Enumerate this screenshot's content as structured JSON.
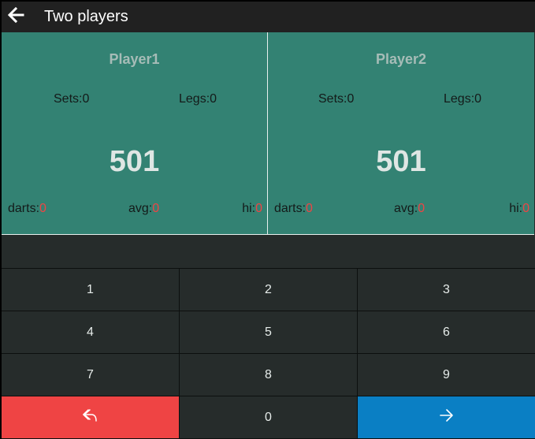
{
  "appbar": {
    "title": "Two players",
    "back_icon": "arrow-left-icon"
  },
  "players": [
    {
      "name": "Player1",
      "sets_label": "Sets:0",
      "legs_label": "Legs:0",
      "score": "501",
      "darts_label": "darts:",
      "darts_value": "0",
      "avg_label": "avg:",
      "avg_value": "0",
      "hi_label": "hi:",
      "hi_value": "0"
    },
    {
      "name": "Player2",
      "sets_label": "Sets:0",
      "legs_label": "Legs:0",
      "score": "501",
      "darts_label": "darts:",
      "darts_value": "0",
      "avg_label": "avg:",
      "avg_value": "0",
      "hi_label": "hi:",
      "hi_value": "0"
    }
  ],
  "keypad": {
    "keys": [
      "1",
      "2",
      "3",
      "4",
      "5",
      "6",
      "7",
      "8",
      "9"
    ],
    "zero": "0",
    "undo_icon": "undo-icon",
    "next_icon": "arrow-right-icon"
  },
  "colors": {
    "player_panel": "#338273",
    "undo": "#ef4444",
    "next": "#0a7fc4",
    "stat_value": "#ef4444"
  }
}
